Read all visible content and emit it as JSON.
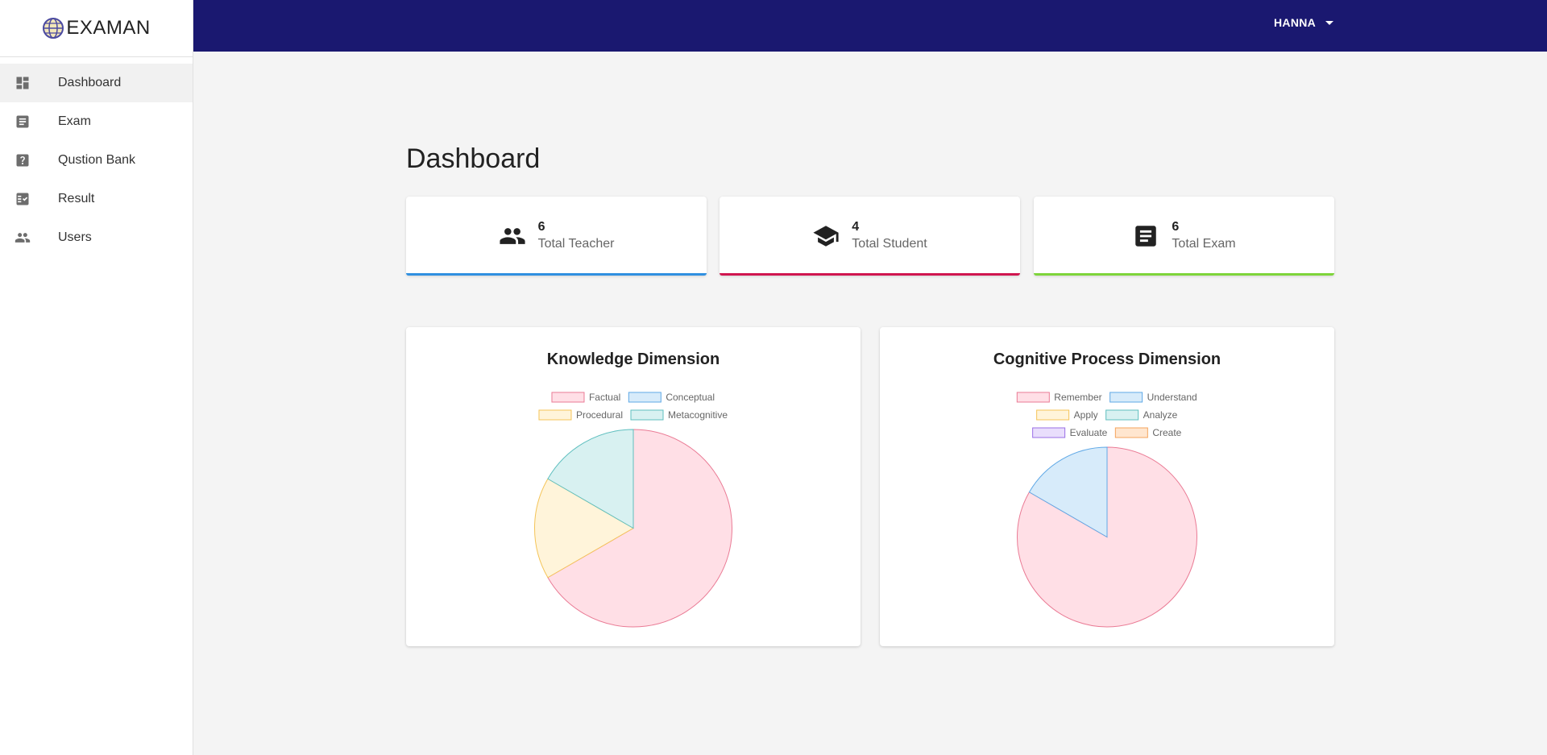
{
  "app": {
    "name": "EXAMAN"
  },
  "sidebar": {
    "items": [
      {
        "label": "Dashboard",
        "icon": "dashboard-icon",
        "active": true
      },
      {
        "label": "Exam",
        "icon": "document-icon",
        "active": false
      },
      {
        "label": "Qustion Bank",
        "icon": "help-icon",
        "active": false
      },
      {
        "label": "Result",
        "icon": "checklist-icon",
        "active": false
      },
      {
        "label": "Users",
        "icon": "people-icon",
        "active": false
      }
    ]
  },
  "topbar": {
    "user_name": "HANNA"
  },
  "main": {
    "title": "Dashboard",
    "stats": [
      {
        "value": "6",
        "label": "Total Teacher",
        "icon": "people-icon",
        "color": "#2f8fe0"
      },
      {
        "value": "4",
        "label": "Total Student",
        "icon": "school-icon",
        "color": "#d0164f"
      },
      {
        "value": "6",
        "label": "Total Exam",
        "icon": "document-icon",
        "color": "#7ed43a"
      }
    ]
  },
  "chart_data": [
    {
      "type": "pie",
      "title": "Knowledge Dimension",
      "categories": [
        "Factual",
        "Conceptual",
        "Procedural",
        "Metacognitive"
      ],
      "values": [
        4,
        0,
        1,
        1
      ],
      "colors": {
        "fill": [
          "#ffdfe6",
          "#d7ebfa",
          "#fff4da",
          "#d8f1f1"
        ],
        "stroke": [
          "#ea7b95",
          "#5fa8e6",
          "#f4c458",
          "#5fbfbf"
        ]
      },
      "legend": "top"
    },
    {
      "type": "pie",
      "title": "Cognitive Process Dimension",
      "categories": [
        "Remember",
        "Understand",
        "Apply",
        "Analyze",
        "Evaluate",
        "Create"
      ],
      "values": [
        5,
        1,
        0,
        0,
        0,
        0
      ],
      "colors": {
        "fill": [
          "#ffdfe6",
          "#d7ebfa",
          "#fff4da",
          "#d8f1f1",
          "#e9defc",
          "#ffe6cf"
        ],
        "stroke": [
          "#ea7b95",
          "#5fa8e6",
          "#f4c458",
          "#5fbfbf",
          "#9a6fe6",
          "#f4a45c"
        ]
      },
      "legend": "top"
    }
  ]
}
